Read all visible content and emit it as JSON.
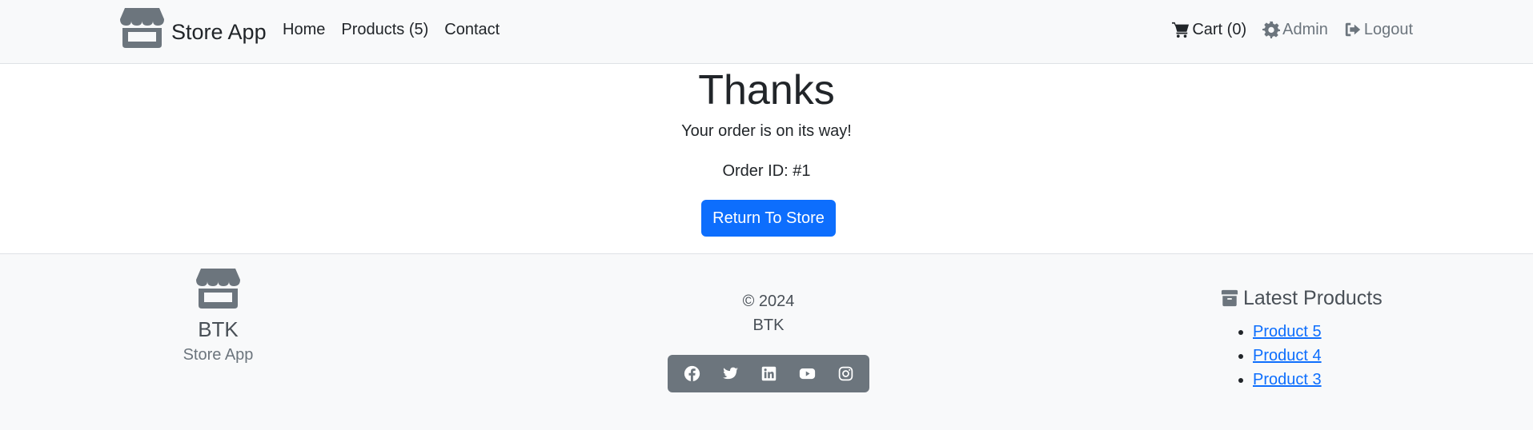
{
  "nav": {
    "brand": "Store App",
    "links": [
      {
        "label": "Home"
      },
      {
        "label": "Products (5)"
      },
      {
        "label": "Contact"
      }
    ],
    "cart_label": "Cart (0)",
    "admin_label": "Admin",
    "logout_label": "Logout"
  },
  "main": {
    "heading": "Thanks",
    "message": "Your order is on its way!",
    "order_id": "Order ID: #1",
    "return_button": "Return To Store"
  },
  "footer": {
    "brand": "BTK",
    "app": "Store App",
    "copyright": "© 2024",
    "company": "BTK",
    "social_icons": [
      "facebook-icon",
      "twitter-icon",
      "linkedin-icon",
      "youtube-icon",
      "instagram-icon"
    ],
    "latest_title": "Latest Products",
    "latest_products": [
      "Product 5",
      "Product 4",
      "Product 3"
    ]
  },
  "colors": {
    "primary": "#0d6efd",
    "navbar_bg": "#f8f9fa",
    "muted": "#6c757d",
    "text": "#212529"
  }
}
